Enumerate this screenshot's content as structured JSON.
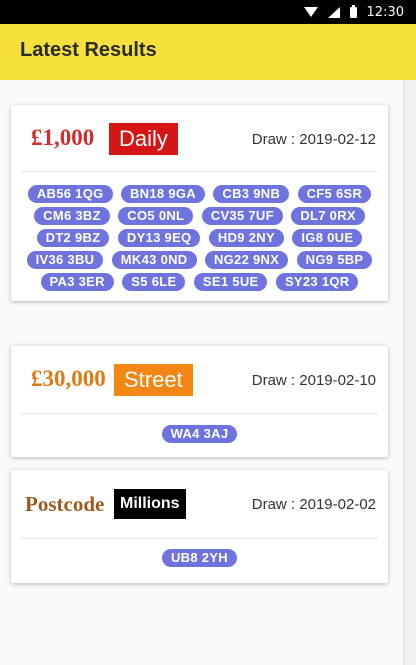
{
  "statusbar": {
    "time": "12:30",
    "icons": [
      "wifi-icon",
      "signal-icon",
      "battery-icon"
    ]
  },
  "appbar": {
    "title": "Latest Results",
    "color": "#f6e03c"
  },
  "cards": [
    {
      "prize": "£1,000",
      "tag": "Daily",
      "draw": "Draw : 2019-02-12",
      "postcodes": [
        "AB56 1QG",
        "BN18 9GA",
        "CB3 9NB",
        "CF5 6SR",
        "CM6 3BZ",
        "CO5 0NL",
        "CV35 7UF",
        "DL7 0RX",
        "DT2 9BZ",
        "DY13 9EQ",
        "HD9 2NY",
        "IG8 0UE",
        "IV36 3BU",
        "MK43 0ND",
        "NG22 9NX",
        "NG9 5BP",
        "PA3 3ER",
        "S5 6LE",
        "SE1 5UE",
        "SY23 1QR"
      ]
    },
    {
      "prize": "£30,000",
      "tag": "Street",
      "draw": "Draw : 2019-02-10",
      "postcodes": [
        "WA4 3AJ"
      ]
    },
    {
      "logo_word": "Postcode",
      "logo_box": "Millions",
      "draw": "Draw : 2019-02-02",
      "postcodes": [
        "UB8 2YH"
      ]
    }
  ],
  "colors": {
    "chip": "#6f73dd",
    "daily": "#d51616",
    "street": "#f18612"
  }
}
